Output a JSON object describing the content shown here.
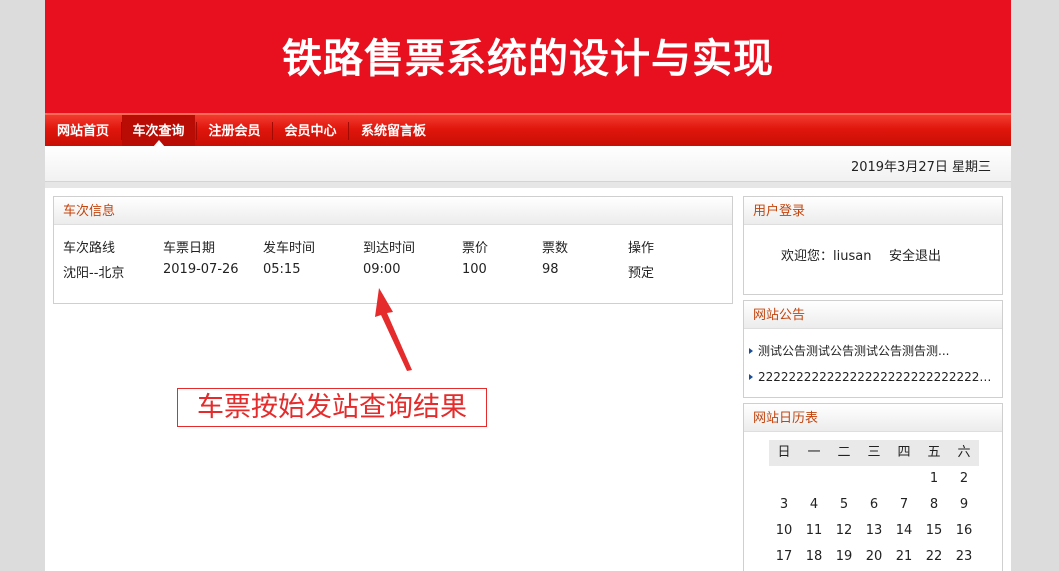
{
  "site": {
    "title": "铁路售票系统的设计与实现"
  },
  "nav": {
    "items": [
      {
        "label": "网站首页"
      },
      {
        "label": "车次查询",
        "active": true
      },
      {
        "label": "注册会员"
      },
      {
        "label": "会员中心"
      },
      {
        "label": "系统留言板"
      }
    ]
  },
  "datebar": {
    "date": "2019年3月27日 星期三"
  },
  "train_panel": {
    "title": "车次信息",
    "headers": [
      "车次路线",
      "车票日期",
      "发车时间",
      "到达时间",
      "票价",
      "票数",
      "操作"
    ],
    "rows": [
      [
        "沈阳--北京",
        "2019-07-26",
        "05:15",
        "09:00",
        "100",
        "98",
        "预定"
      ]
    ]
  },
  "login_panel": {
    "title": "用户登录",
    "welcome_label": "欢迎您：",
    "username": "liusan",
    "logout": "安全退出"
  },
  "notice_panel": {
    "title": "网站公告",
    "items": [
      "测试公告测试公告测试公告测告测...",
      "222222222222222222222222222222..."
    ]
  },
  "calendar_panel": {
    "title": "网站日历表",
    "weekdays": [
      "日",
      "一",
      "二",
      "三",
      "四",
      "五",
      "六"
    ],
    "weeks": [
      [
        "",
        "",
        "",
        "",
        "",
        "1",
        "2"
      ],
      [
        "3",
        "4",
        "5",
        "6",
        "7",
        "8",
        "9"
      ],
      [
        "10",
        "11",
        "12",
        "13",
        "14",
        "15",
        "16"
      ],
      [
        "17",
        "18",
        "19",
        "20",
        "21",
        "22",
        "23"
      ]
    ]
  },
  "annotation": {
    "text": "车票按始发站查询结果"
  },
  "colors": {
    "brand_red": "#e8101f",
    "panel_title": "#c2440e",
    "annotation_red": "#e52b2b"
  }
}
